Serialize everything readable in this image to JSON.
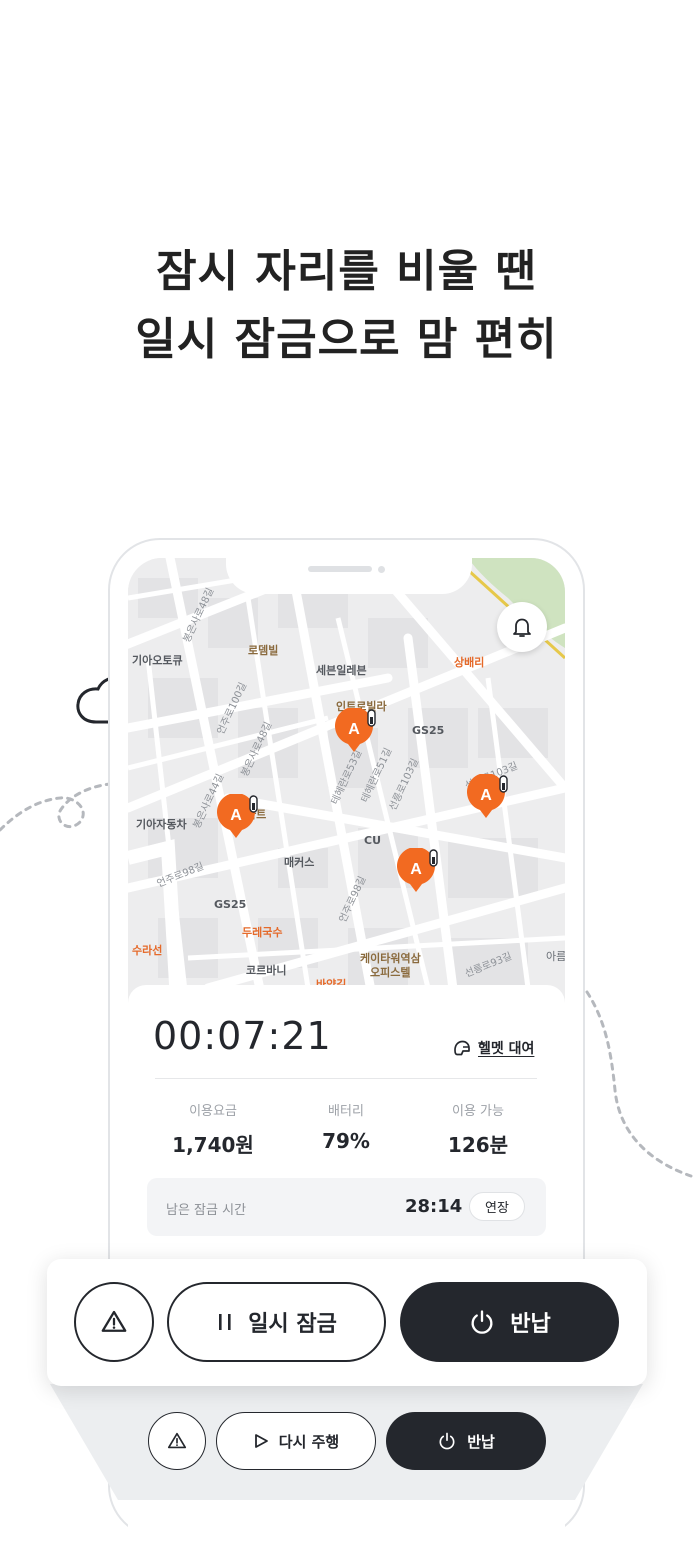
{
  "headline": {
    "line1": "잠시 자리를 비울 땐",
    "line2": "일시 잠금으로 맘 편히"
  },
  "map": {
    "labels": {
      "kia_auto_q": "기아오토큐",
      "lodem_villa": "로뎀빌",
      "seven_eleven": "세븐일레븐",
      "intro_villa": "인트로빌라",
      "gs25_a": "GS25",
      "sangbaeri": "상배리",
      "kia_motors": "기아자동차",
      "apt": "아트",
      "cu": "CU",
      "maekus": "매커스",
      "gs25_b": "GS25",
      "durae_guksu": "두레국수",
      "surasun": "수라선",
      "corbani": "코르바니",
      "ktower_opi": "케이타워역삼\n오피스텔",
      "kt_line1": "케이타워역삼",
      "kt_line2": "오피스텔",
      "pharmacy": "바약길",
      "road_1": "언주로100길",
      "road_2": "봉은사로48길",
      "road_3": "언주로98길",
      "road_4": "테헤란로53길",
      "road_5": "선릉로103길",
      "road_6": "선릉로93길",
      "road_7": "언주로100길",
      "road_8": "봉은사로44길",
      "road_9": "테헤란로51길",
      "road_10": "봉은사로48길",
      "area": "아름"
    },
    "pin_letter": "A",
    "accent": "#f26a21"
  },
  "trip": {
    "timer": "00:07:21",
    "helmet_label": "헬멧 대여",
    "stats": [
      {
        "label": "이용요금",
        "value": "1,740원"
      },
      {
        "label": "배터리",
        "value": "79%"
      },
      {
        "label": "이용 가능",
        "value": "126분"
      }
    ],
    "lock_label": "남은 잠금 시간",
    "lock_time": "28:14",
    "extend_label": "연장"
  },
  "actions": {
    "report_icon": "warning-icon",
    "pause_label": "일시 잠금",
    "return_label": "반납"
  },
  "actions_small": {
    "resume_label": "다시 주행",
    "return_label": "반납"
  },
  "colors": {
    "dark": "#24272d",
    "accent": "#f26a21",
    "map_bg": "#ededee"
  }
}
